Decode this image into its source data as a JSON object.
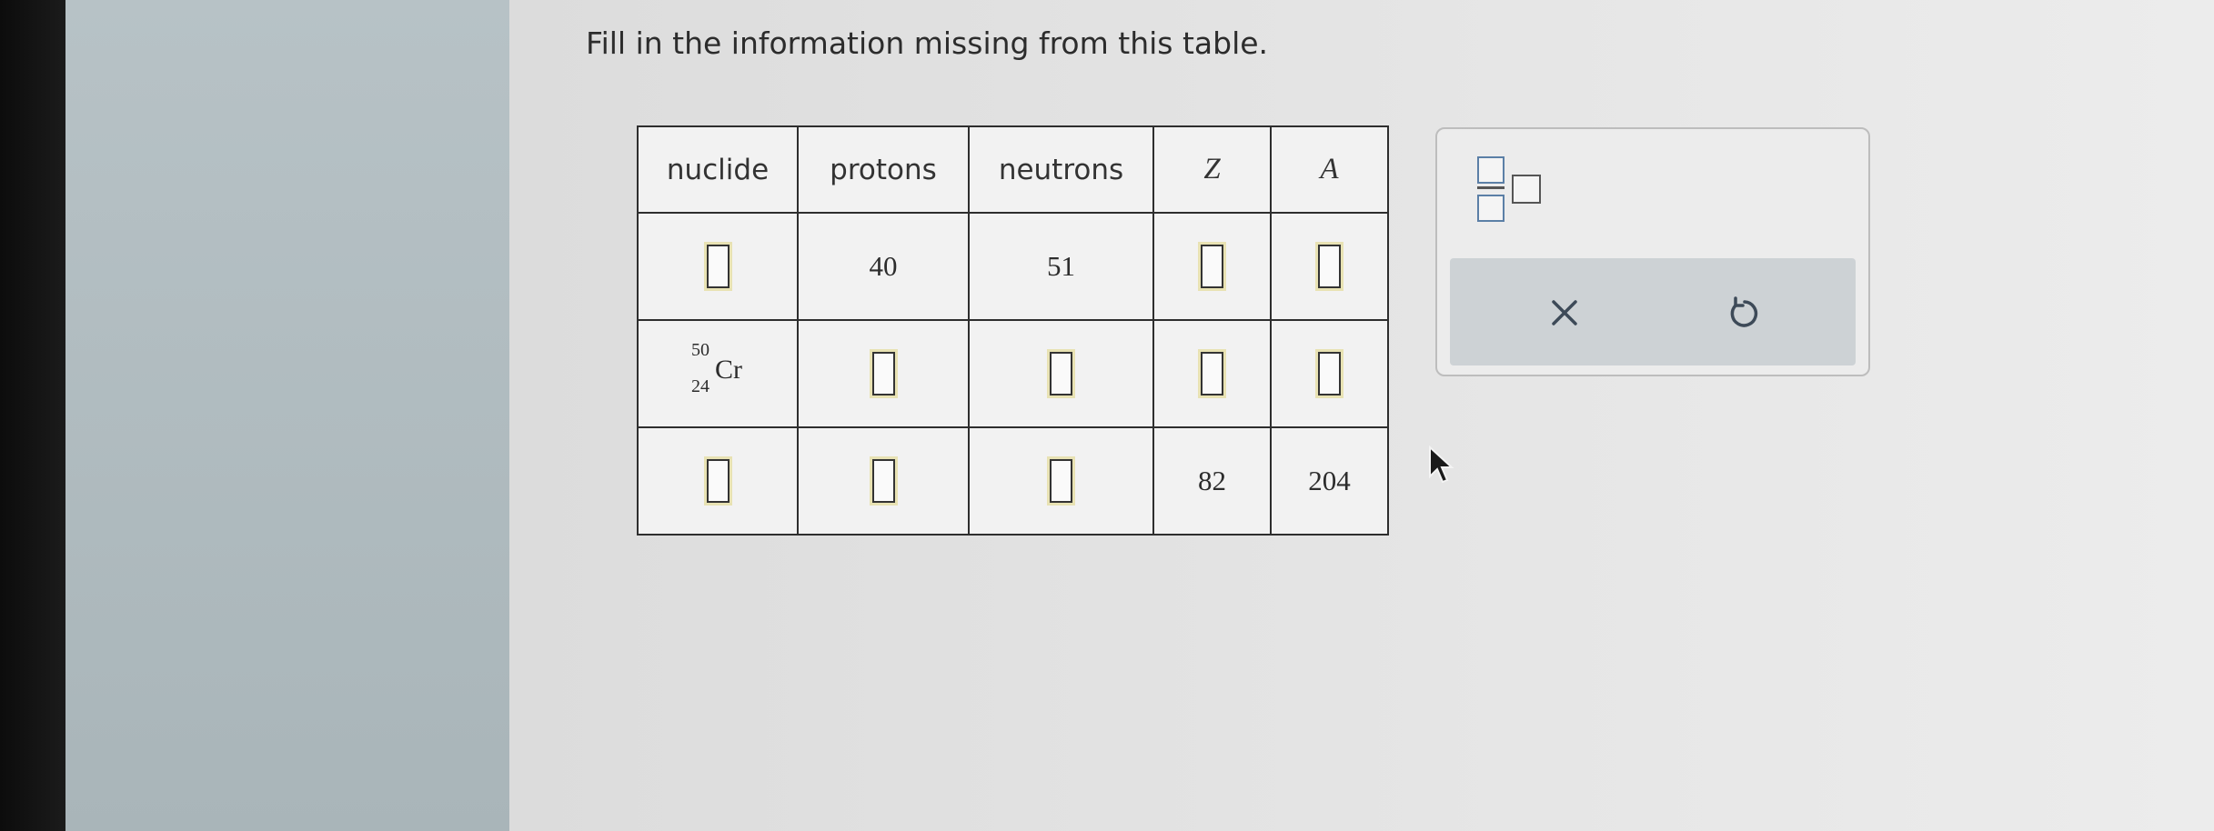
{
  "prompt": "Fill in the information missing from this table.",
  "table": {
    "headers": [
      "nuclide",
      "protons",
      "neutrons",
      "Z",
      "A"
    ],
    "rows": [
      {
        "nuclide": null,
        "protons": "40",
        "neutrons": "51",
        "Z": null,
        "A": null
      },
      {
        "nuclide": {
          "mass": "50",
          "atomic": "24",
          "element": "Cr"
        },
        "protons": null,
        "neutrons": null,
        "Z": null,
        "A": null
      },
      {
        "nuclide": null,
        "protons": null,
        "neutrons": null,
        "Z": "82",
        "A": "204"
      }
    ]
  },
  "tools": {
    "fraction_icon": "fraction-template-icon",
    "clear_icon": "close-icon",
    "undo_icon": "undo-icon"
  },
  "colors": {
    "left_panel": "#b0bbbf",
    "page": "#e4e4e4",
    "answer_box_highlight": "#e8e2b3",
    "action_bar": "#cdd2d5"
  }
}
